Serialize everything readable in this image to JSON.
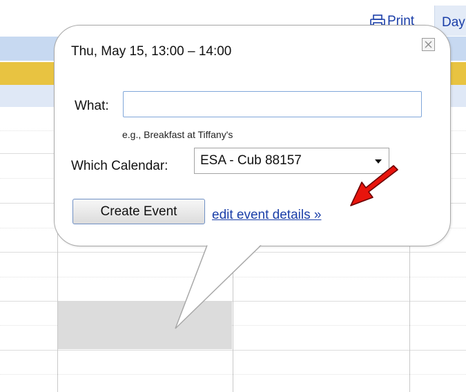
{
  "toolbar": {
    "print_label": "Print",
    "print_icon": "printer-icon",
    "day_tab_label": "Day"
  },
  "popup": {
    "datetime": "Thu, May 15, 13:00 – 14:00",
    "close_icon": "close-icon",
    "what_label": "What:",
    "what_value": "",
    "what_hint": "e.g., Breakfast at Tiffany's",
    "calendar_label": "Which Calendar:",
    "calendar_selected": "ESA - Cub 88157",
    "create_button_label": "Create Event",
    "edit_link_label": "edit event details »"
  },
  "annotation": {
    "arrow_color": "#e8140c",
    "arrow_icon": "red-arrow-icon"
  },
  "colors": {
    "link": "#1a3ea8",
    "header_band": "#c7d9f1",
    "allday_band": "#e8c341",
    "selected_slot": "#dcdcdc"
  }
}
